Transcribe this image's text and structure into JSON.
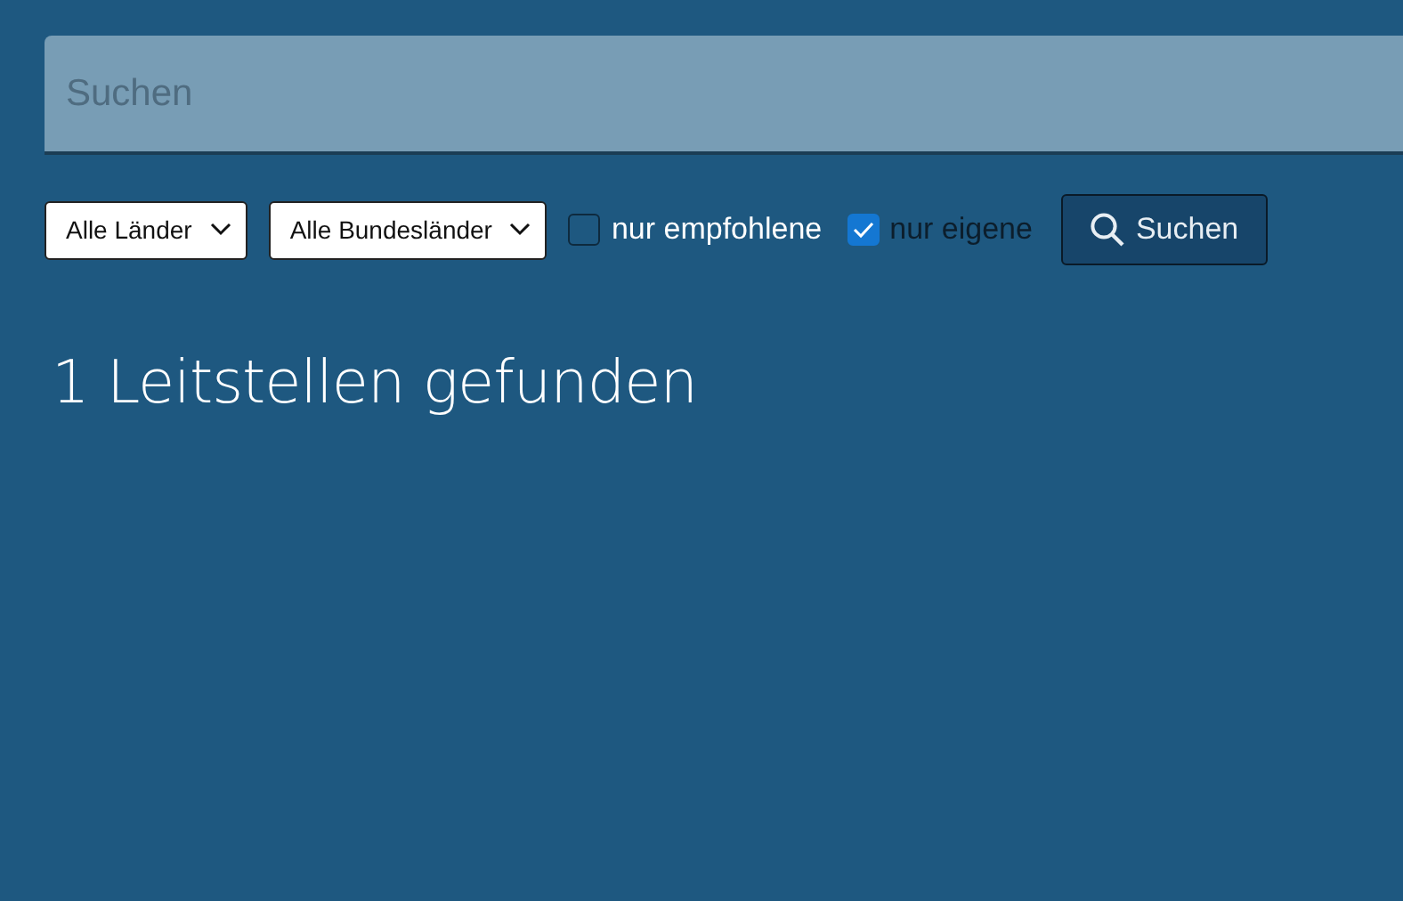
{
  "search": {
    "placeholder": "Suchen"
  },
  "filters": [
    {
      "kind": "dropdown",
      "value": "Alle Länder"
    },
    {
      "kind": "dropdown",
      "value": "Alle Bundesländer"
    },
    {
      "kind": "checkbox",
      "label": "nur empfohlene",
      "checked": false
    },
    {
      "kind": "checkbox",
      "label": "nur eigene",
      "checked": true
    }
  ],
  "search_button": {
    "label": "Suchen"
  },
  "result_heading": "1 Leitstellen gefunden"
}
